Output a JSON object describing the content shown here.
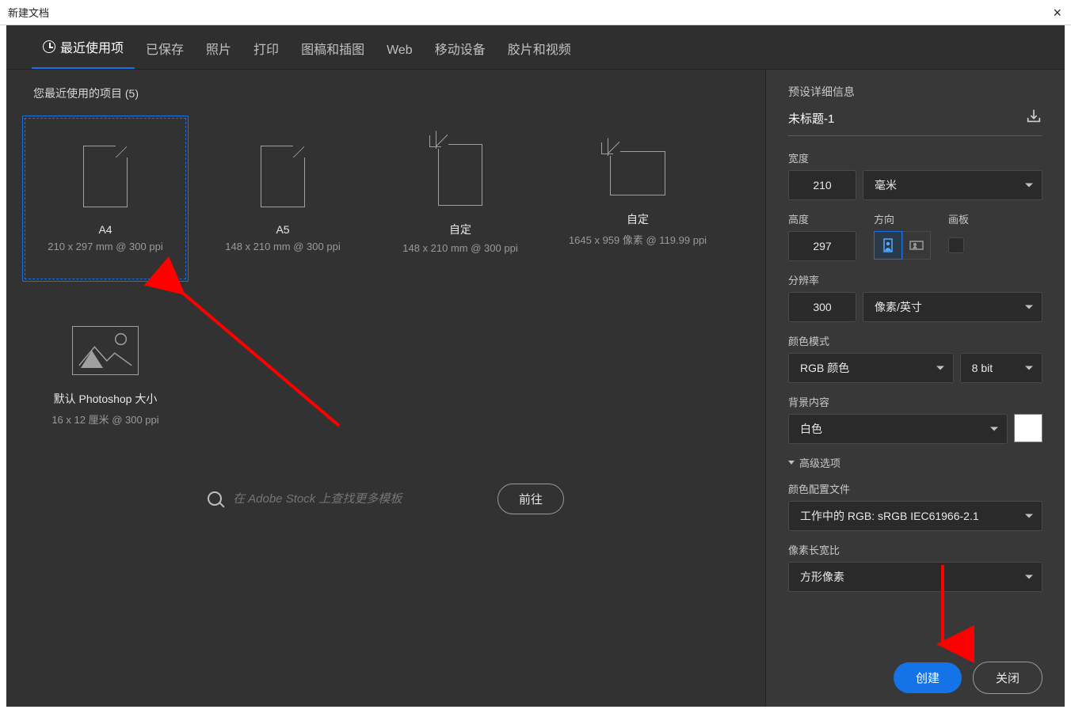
{
  "titlebar": {
    "title": "新建文档"
  },
  "tabs": [
    {
      "label": "最近使用项",
      "active": true,
      "icon": "clock"
    },
    {
      "label": "已保存"
    },
    {
      "label": "照片"
    },
    {
      "label": "打印"
    },
    {
      "label": "图稿和插图"
    },
    {
      "label": "Web"
    },
    {
      "label": "移动设备"
    },
    {
      "label": "胶片和视频"
    }
  ],
  "recent": {
    "header": "您最近使用的项目  (5)",
    "items": [
      {
        "name": "A4",
        "sub": "210 x 297 mm @ 300 ppi",
        "thumb": "doc",
        "selected": true
      },
      {
        "name": "A5",
        "sub": "148 x 210 mm @ 300 ppi",
        "thumb": "doc"
      },
      {
        "name": "自定",
        "sub": "148 x 210 mm @ 300 ppi",
        "thumb": "crop"
      },
      {
        "name": "自定",
        "sub": "1645 x 959 像素 @ 119.99 ppi",
        "thumb": "crop-land"
      },
      {
        "name": "默认 Photoshop 大小",
        "sub": "16 x 12 厘米 @ 300 ppi",
        "thumb": "image"
      }
    ]
  },
  "stock": {
    "placeholder": "在 Adobe Stock 上查找更多模板",
    "go": "前往"
  },
  "details": {
    "title": "预设详细信息",
    "docname": "未标题-1",
    "width_label": "宽度",
    "width": "210",
    "width_unit": "毫米",
    "height_label": "高度",
    "height": "297",
    "orientation_label": "方向",
    "artboard_label": "画板",
    "resolution_label": "分辨率",
    "resolution": "300",
    "resolution_unit": "像素/英寸",
    "color_mode_label": "颜色模式",
    "color_mode": "RGB 颜色",
    "bit_depth": "8 bit",
    "background_label": "背景内容",
    "background": "白色",
    "advanced_label": "高级选项",
    "profile_label": "颜色配置文件",
    "profile": "工作中的 RGB: sRGB IEC61966-2.1",
    "ratio_label": "像素长宽比",
    "ratio": "方形像素"
  },
  "footer": {
    "create": "创建",
    "close": "关闭"
  }
}
